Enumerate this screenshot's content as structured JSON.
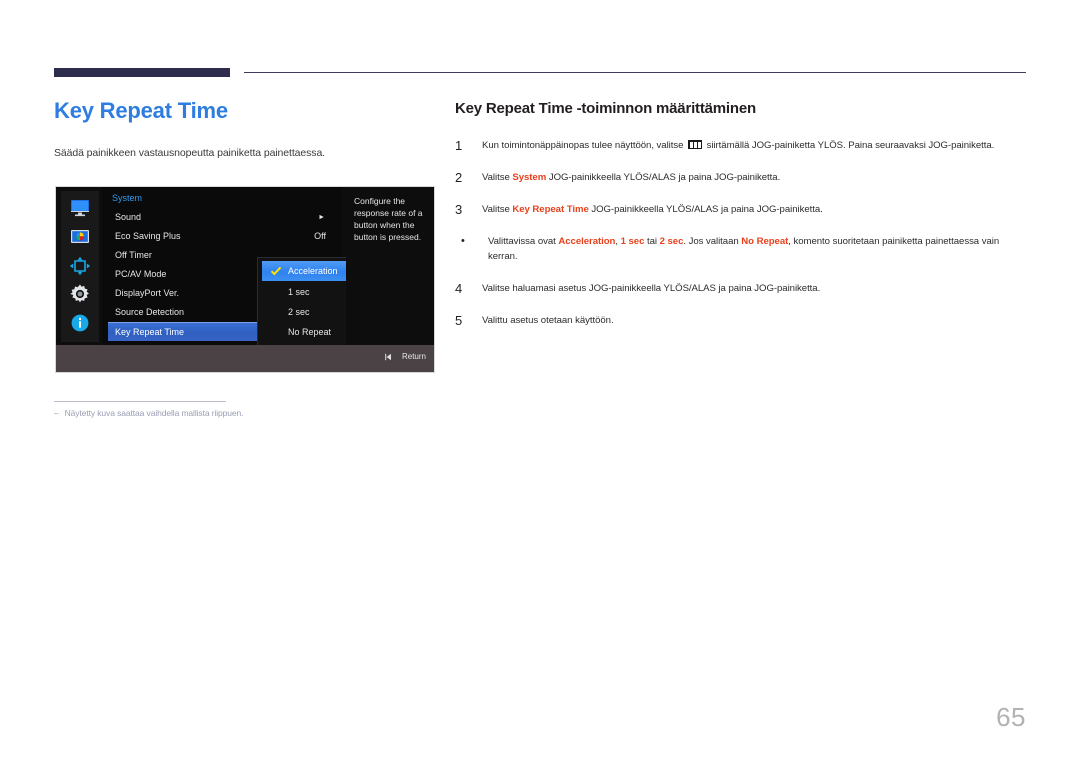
{
  "document": {
    "page_number": "65"
  },
  "left": {
    "title": "Key Repeat Time",
    "subtitle": "Säädä painikkeen vastausnopeutta painiketta painettaessa.",
    "footnote_dash": "‒",
    "footnote": "Näytetty kuva saattaa vaihdella mallista riippuen."
  },
  "osd": {
    "menu_title": "System",
    "rail_icons": [
      "display-icon",
      "picture-icon",
      "navigation-icon",
      "settings-gear-icon",
      "information-icon"
    ],
    "items": [
      {
        "label": "Sound",
        "value": "",
        "arrow": "►",
        "selected": false
      },
      {
        "label": "Eco Saving Plus",
        "value": "Off",
        "arrow": "",
        "selected": false
      },
      {
        "label": "Off Timer",
        "value": "",
        "arrow": "",
        "selected": false
      },
      {
        "label": "PC/AV Mode",
        "value": "",
        "arrow": "",
        "selected": false
      },
      {
        "label": "DisplayPort Ver.",
        "value": "",
        "arrow": "",
        "selected": false
      },
      {
        "label": "Source Detection",
        "value": "",
        "arrow": "",
        "selected": false
      },
      {
        "label": "Key Repeat Time",
        "value": "",
        "arrow": "",
        "selected": true
      }
    ],
    "submenu": [
      {
        "label": "Acceleration",
        "checked": true,
        "selected": true
      },
      {
        "label": "1 sec",
        "checked": false,
        "selected": false
      },
      {
        "label": "2 sec",
        "checked": false,
        "selected": false
      },
      {
        "label": "No Repeat",
        "checked": false,
        "selected": false
      }
    ],
    "description": "Configure the response rate of a button when the button is pressed.",
    "return_label": "Return",
    "colors": {
      "highlight_blue": "#3b6fd4",
      "submenu_blue": "#2f82ef",
      "title_blue": "#2f9bf2",
      "check_yellow": "#ffe600"
    }
  },
  "right": {
    "title": "Key Repeat Time -toiminnon määrittäminen",
    "steps": [
      {
        "number": "1",
        "bullet": false,
        "parts": [
          {
            "t": "Kun toimintonäppäinopas tulee näyttöön, valitse ",
            "s": "plain"
          },
          {
            "t": "",
            "s": "menu-icon"
          },
          {
            "t": " siirtämällä JOG-painiketta YLÖS. Paina seuraavaksi JOG-painiketta.",
            "s": "plain"
          }
        ]
      },
      {
        "number": "2",
        "bullet": false,
        "parts": [
          {
            "t": "Valitse ",
            "s": "plain"
          },
          {
            "t": "System",
            "s": "hl"
          },
          {
            "t": " JOG-painikkeella YLÖS/ALAS ja paina JOG-painiketta.",
            "s": "plain"
          }
        ]
      },
      {
        "number": "3",
        "bullet": false,
        "parts": [
          {
            "t": "Valitse ",
            "s": "plain"
          },
          {
            "t": "Key Repeat Time",
            "s": "hl"
          },
          {
            "t": " JOG-painikkeella YLÖS/ALAS ja paina JOG-painiketta.",
            "s": "plain"
          }
        ]
      },
      {
        "number": "•",
        "bullet": true,
        "parts": [
          {
            "t": "Valittavissa ovat ",
            "s": "plain"
          },
          {
            "t": "Acceleration",
            "s": "hl"
          },
          {
            "t": ", ",
            "s": "plain"
          },
          {
            "t": "1 sec",
            "s": "hl"
          },
          {
            "t": " tai ",
            "s": "plain"
          },
          {
            "t": "2 sec",
            "s": "hl"
          },
          {
            "t": ". Jos valitaan ",
            "s": "plain"
          },
          {
            "t": "No Repeat",
            "s": "hl"
          },
          {
            "t": ", komento suoritetaan painiketta painettaessa vain kerran.",
            "s": "plain"
          }
        ]
      },
      {
        "number": "4",
        "bullet": false,
        "parts": [
          {
            "t": "Valitse haluamasi asetus JOG-painikkeella YLÖS/ALAS ja paina JOG-painiketta.",
            "s": "plain"
          }
        ]
      },
      {
        "number": "5",
        "bullet": false,
        "parts": [
          {
            "t": "Valittu asetus otetaan käyttöön.",
            "s": "plain"
          }
        ]
      }
    ]
  }
}
